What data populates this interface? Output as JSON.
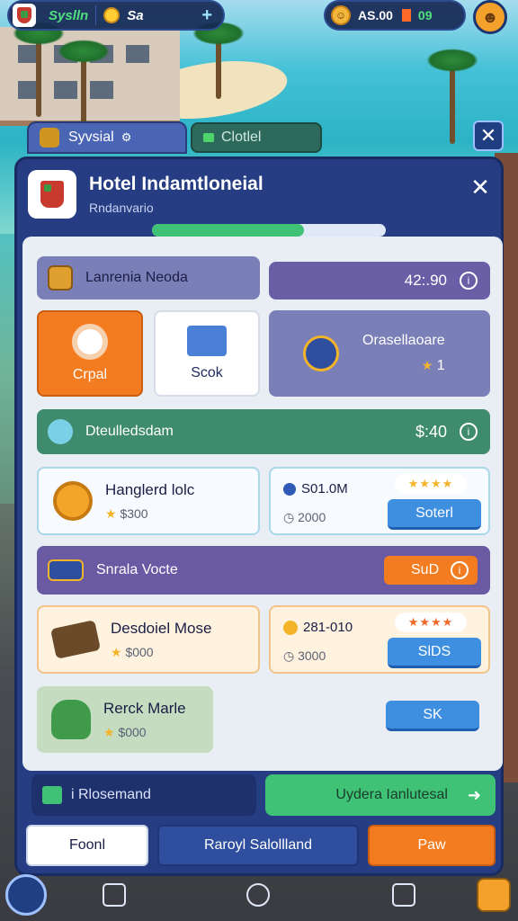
{
  "hud": {
    "left_name": "Syslln",
    "coins": "Sa",
    "plus": "+",
    "right_value": "AS.00",
    "right_count": "09"
  },
  "tabs": [
    {
      "label": "Syvsial"
    },
    {
      "label": "Clotlel"
    }
  ],
  "dialog": {
    "title": "Hotel Indamtloneial",
    "subtitle": "Rndanvario",
    "progress_fraction": 0.65
  },
  "section1": {
    "bar_label": "Lanrenia Neoda",
    "value": "42:.90",
    "cards": [
      {
        "label": "Crpal"
      },
      {
        "label": "Scok"
      }
    ],
    "feature": {
      "label": "Orasellaoare",
      "rating": "1"
    }
  },
  "section2": {
    "bar_label": "Dteulledsdam",
    "price": "$:40",
    "items": [
      {
        "name": "Hanglerd lolc",
        "price": "$300",
        "sub_value": "S01.0M",
        "sub_price": "2000",
        "button": "Soterl"
      },
      {
        "name": "Desdoiel Mose",
        "price": "$000",
        "sub_value": "281-010",
        "sub_price": "3000",
        "button": "SlDS"
      }
    ]
  },
  "section3": {
    "bar_label": "Snrala Vocte",
    "button": "SuD"
  },
  "section4": {
    "item": {
      "name": "Rerck Marle",
      "price": "$000"
    },
    "button": "SK"
  },
  "footer": {
    "left_label": "i Rlosemand",
    "right_label": "Uydera Ianlutesal",
    "buttons": [
      "Foonl",
      "Raroyl Salollland",
      "Paw"
    ]
  },
  "colors": {
    "dialog_bg": "#263d83",
    "accent_orange": "#f47c20",
    "accent_green": "#3fc276",
    "accent_blue": "#3f8fe0"
  }
}
